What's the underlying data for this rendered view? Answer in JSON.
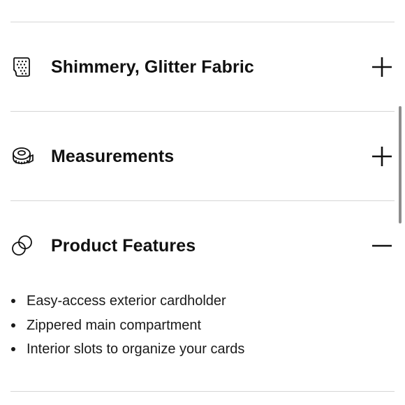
{
  "sections": [
    {
      "title": "Shimmery, Glitter Fabric",
      "icon": "fabric-swatch-icon",
      "toggle_icon": "plus-icon",
      "expanded": false
    },
    {
      "title": "Measurements",
      "icon": "tape-measure-icon",
      "toggle_icon": "plus-icon",
      "expanded": false
    },
    {
      "title": "Product Features",
      "icon": "overlapping-circles-icon",
      "toggle_icon": "minus-icon",
      "expanded": true,
      "items": [
        "Easy-access exterior cardholder",
        "Zippered main compartment",
        "Interior slots to organize your cards"
      ]
    }
  ],
  "colors": {
    "text": "#111111",
    "divider": "#d6d6d6",
    "background": "#ffffff",
    "scrollbar": "#8d8d8d"
  }
}
